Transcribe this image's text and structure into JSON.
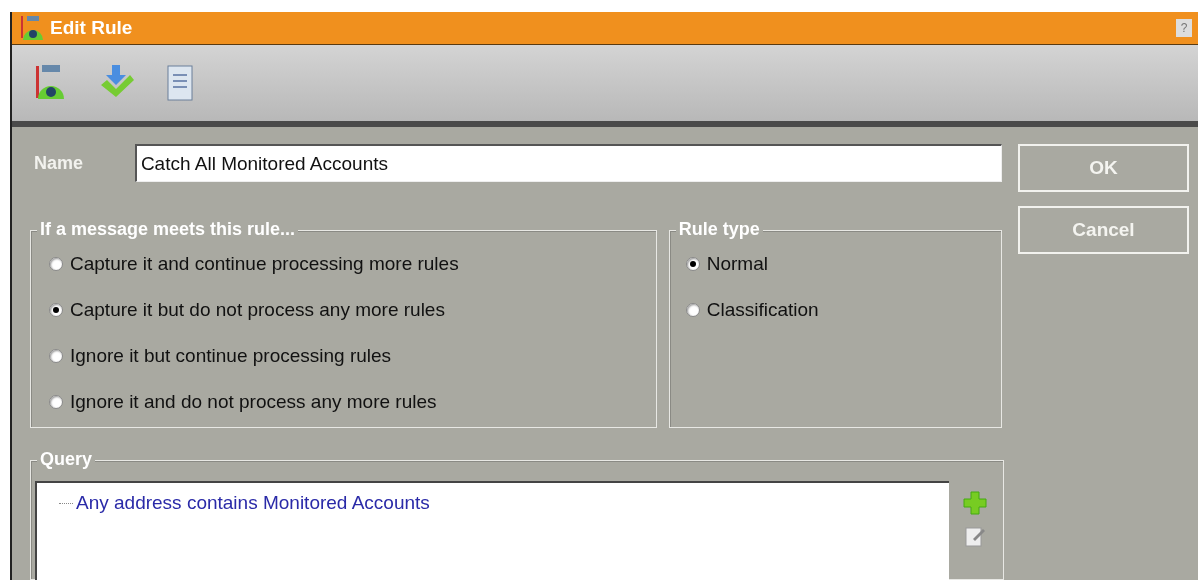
{
  "window": {
    "title": "Edit Rule",
    "help": "?"
  },
  "name_field": {
    "label": "Name",
    "value": "Catch All Monitored Accounts"
  },
  "buttons": [
    "OK",
    "Cancel"
  ],
  "action_group": {
    "title": "If a message meets this rule...",
    "options": [
      {
        "label": "Capture it and continue processing more rules",
        "selected": false
      },
      {
        "label": "Capture it but do not process any more rules",
        "selected": true
      },
      {
        "label": "Ignore it but continue processing rules",
        "selected": false
      },
      {
        "label": "Ignore it and do not process any more rules",
        "selected": false
      }
    ]
  },
  "rule_type_group": {
    "title": "Rule type",
    "options": [
      {
        "label": "Normal",
        "selected": true
      },
      {
        "label": "Classification",
        "selected": false
      }
    ]
  },
  "query": {
    "title": "Query",
    "items": [
      {
        "label": "Any address contains Monitored Accounts"
      }
    ]
  }
}
